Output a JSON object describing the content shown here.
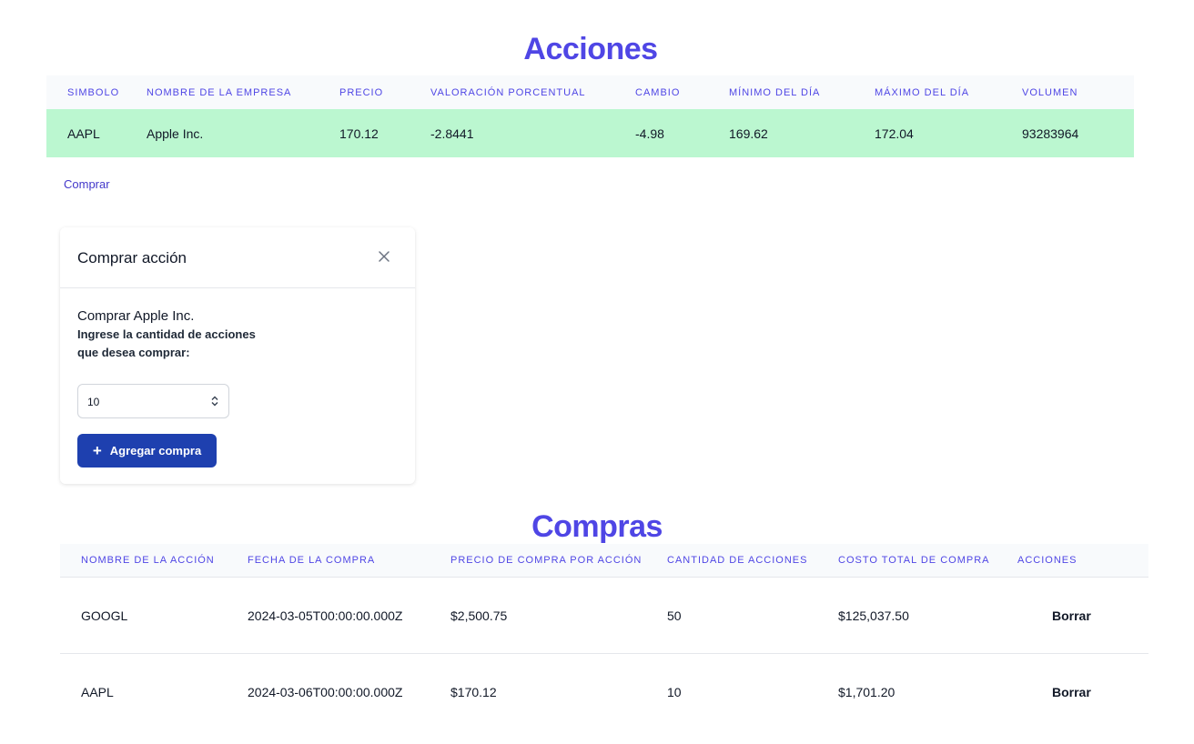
{
  "stocks_title": "Acciones",
  "stocks_table": {
    "headers": [
      "SIMBOLO",
      "NOMBRE DE LA EMPRESA",
      "PRECIO",
      "VALORACIÓN PORCENTUAL",
      "CAMBIO",
      "MÍNIMO DEL DÍA",
      "MÁXIMO DEL DÍA",
      "VOLUMEN"
    ],
    "rows": [
      [
        "AAPL",
        "Apple Inc.",
        "170.12",
        "-2.8441",
        "-4.98",
        "169.62",
        "172.04",
        "93283964"
      ]
    ]
  },
  "buy_link": "Comprar",
  "modal": {
    "title": "Comprar acción",
    "heading": "Comprar Apple Inc.",
    "label": "Ingrese la cantidad de acciones que desea comprar:",
    "quantity_value": "10",
    "add_button": "Agregar compra",
    "plus_icon": "+"
  },
  "purchases_title": "Compras",
  "purchases_table": {
    "headers": [
      "NOMBRE DE LA ACCIÓN",
      "FECHA DE LA COMPRA",
      "PRECIO DE COMPRA POR ACCIÓN",
      "CANTIDAD DE ACCIONES",
      "COSTO TOTAL DE COMPRA",
      "ACCIONES"
    ],
    "rows": [
      [
        "GOOGL",
        "2024-03-05T00:00:00.000Z",
        "$2,500.75",
        "50",
        "$125,037.50",
        "Borrar"
      ],
      [
        "AAPL",
        "2024-03-06T00:00:00.000Z",
        "$170.12",
        "10",
        "$1,701.20",
        "Borrar"
      ]
    ]
  },
  "colors": {
    "accent": "#4f46e5",
    "row_highlight": "#bbf7d0",
    "button": "#1e40af"
  }
}
